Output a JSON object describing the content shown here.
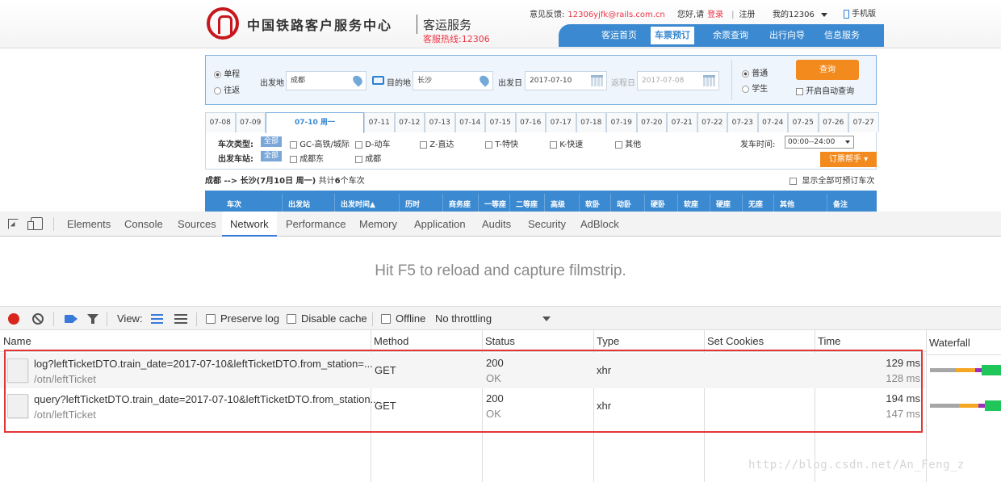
{
  "site": {
    "logo_text": "中国铁路客户服务中心",
    "logo_sub": "客运服务",
    "hotline": "客服热线:12306",
    "feedback_label": "意见反馈:",
    "feedback_email": "12306yjfk@rails.com.cn",
    "greeting": "您好,请",
    "login": "登录",
    "register": "注册",
    "my12306": "我的12306",
    "mobile": "手机版",
    "nav": [
      "客运首页",
      "车票预订",
      "余票查询",
      "出行向导",
      "信息服务"
    ],
    "nav_active": "车票预订"
  },
  "search": {
    "trip_single": "单程",
    "trip_return": "往返",
    "from_label": "出发地",
    "from_value": "成都",
    "to_label": "目的地",
    "to_value": "长沙",
    "date_label": "出发日",
    "date_value": "2017-07-10",
    "return_label": "返程日",
    "return_value": "2017-07-08",
    "type_normal": "普通",
    "type_student": "学生",
    "query_btn": "查询",
    "auto_query": "开启自动查询"
  },
  "date_tabs": [
    "07-08",
    "07-09",
    "07-10 周一",
    "07-11",
    "07-12",
    "07-13",
    "07-14",
    "07-15",
    "07-16",
    "07-17",
    "07-18",
    "07-19",
    "07-20",
    "07-21",
    "07-22",
    "07-23",
    "07-24",
    "07-25",
    "07-26",
    "07-27"
  ],
  "filters": {
    "train_type_label": "车次类型:",
    "all": "全部",
    "types": [
      "GC-高铁/城际",
      "D-动车",
      "Z-直达",
      "T-特快",
      "K-快速",
      "其他"
    ],
    "depart_time_label": "发车时间:",
    "depart_time_value": "00:00--24:00",
    "station_label": "出发车站:",
    "stations": [
      "成都东",
      "成都"
    ],
    "dingpiao": "订票帮手"
  },
  "result": {
    "route": "成都 --> 长沙(7月10日 周一)",
    "count_prefix": "共计",
    "count": "6",
    "count_suffix": "个车次",
    "show_all": "显示全部可预订车次",
    "headers": [
      "车次",
      "出发站",
      "出发时间▲",
      "历时",
      "商务座",
      "一等座",
      "二等座",
      "高级",
      "软卧",
      "动卧",
      "硬卧",
      "软座",
      "硬座",
      "无座",
      "其他",
      "备注"
    ]
  },
  "devtools": {
    "tabs": [
      "Elements",
      "Console",
      "Sources",
      "Network",
      "Performance",
      "Memory",
      "Application",
      "Audits",
      "Security",
      "AdBlock"
    ],
    "active_tab": "Network",
    "filmstrip_msg": "Hit F5 to reload and capture filmstrip.",
    "view_label": "View:",
    "preserve_log": "Preserve log",
    "disable_cache": "Disable cache",
    "offline": "Offline",
    "throttling": "No throttling",
    "columns": [
      "Name",
      "Method",
      "Status",
      "Type",
      "Set Cookies",
      "Time",
      "Waterfall"
    ],
    "requests": [
      {
        "name": "log?leftTicketDTO.train_date=2017-07-10&leftTicketDTO.from_station=...",
        "path": "/otn/leftTicket",
        "method": "GET",
        "status": "200",
        "status_text": "OK",
        "type": "xhr",
        "time": "129 ms",
        "latency": "128 ms"
      },
      {
        "name": "query?leftTicketDTO.train_date=2017-07-10&leftTicketDTO.from_station...",
        "path": "/otn/leftTicket",
        "method": "GET",
        "status": "200",
        "status_text": "OK",
        "type": "xhr",
        "time": "194 ms",
        "latency": "147 ms"
      }
    ]
  },
  "watermark": "http://blog.csdn.net/An_Feng_z",
  "colors": {
    "accent": "#3a89d1",
    "orange": "#f28a1e",
    "red": "#e23636",
    "record": "#d9261c"
  }
}
